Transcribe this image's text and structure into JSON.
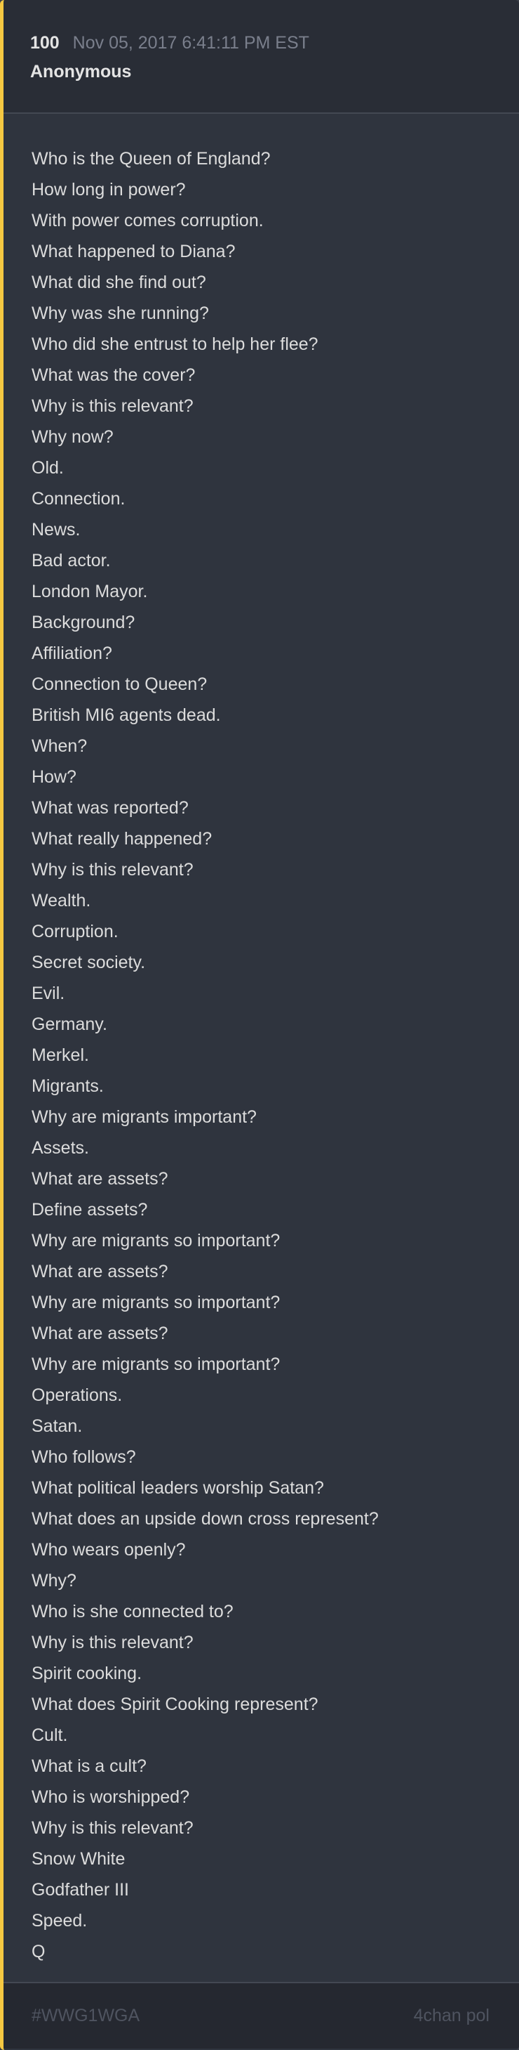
{
  "post": {
    "number": "100",
    "timestamp": "Nov 05, 2017 6:41:11 PM EST",
    "author": "Anonymous",
    "lines": [
      "Who is the Queen of England?",
      "How long in power?",
      "With power comes corruption.",
      "What happened to Diana?",
      "What did she find out?",
      "Why was she running?",
      "Who did she entrust to help her flee?",
      "What was the cover?",
      "Why is this relevant?",
      "Why now?",
      "Old.",
      "Connection.",
      "News.",
      "Bad actor.",
      "London Mayor.",
      "Background?",
      "Affiliation?",
      "Connection to Queen?",
      "British MI6 agents dead.",
      "When?",
      "How?",
      "What was reported?",
      "What really happened?",
      "Why is this relevant?",
      "Wealth.",
      "Corruption.",
      "Secret society.",
      "Evil.",
      "Germany.",
      "Merkel.",
      "Migrants.",
      "Why are migrants important?",
      "Assets.",
      "What are assets?",
      "Define assets?",
      "Why are migrants so important?",
      "What are assets?",
      "Why are migrants so important?",
      "What are assets?",
      "Why are migrants so important?",
      "Operations.",
      "Satan.",
      "Who follows?",
      "What political leaders worship Satan?",
      "What does an upside down cross represent?",
      "Who wears openly?",
      "Why?",
      "Who is she connected to?",
      "Why is this relevant?",
      "Spirit cooking.",
      "What does Spirit Cooking represent?",
      "Cult.",
      "What is a cult?",
      "Who is worshipped?",
      "Why is this relevant?",
      "Snow White",
      "Godfather III",
      "Speed.",
      "Q"
    ]
  },
  "footer": {
    "hashtag": "#WWG1WGA",
    "source": "4chan pol"
  },
  "colors": {
    "accent": "#f5c842"
  }
}
